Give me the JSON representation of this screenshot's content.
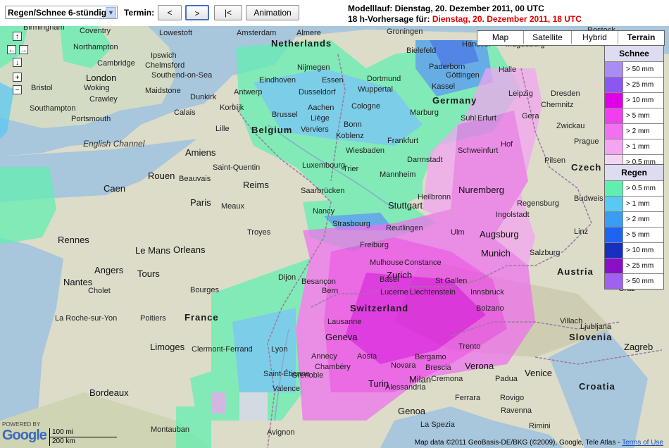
{
  "toolbar": {
    "product_select": "Regen/Schnee 6-stündig",
    "termin_label": "Termin:",
    "prev_label": "<",
    "next_label": ">",
    "first_label": "|<",
    "animation_label": "Animation"
  },
  "run_info": {
    "modelllauf": "Modelllauf: Dienstag, 20. Dezember 2011, 00 UTC",
    "forecast_prefix": "18 h-Vorhersage für:",
    "forecast_value": "Dienstag, 20. Dezember 2011, 18 UTC"
  },
  "map_types": [
    "Map",
    "Satellite",
    "Hybrid",
    "Terrain"
  ],
  "active_map_type": "Terrain",
  "legend_snow": {
    "title": "Schnee",
    "rows": [
      {
        "label": "> 50 mm",
        "color": "#a98cf4"
      },
      {
        "label": "> 25 mm",
        "color": "#8a58f0"
      },
      {
        "label": "> 10 mm",
        "color": "#e000e8"
      },
      {
        "label": "> 5 mm",
        "color": "#f040ee"
      },
      {
        "label": "> 2 mm",
        "color": "#f070f0"
      },
      {
        "label": "> 1 mm",
        "color": "#f4a4f2"
      },
      {
        "label": "> 0.5 mm",
        "color": "#f3d4f3"
      }
    ]
  },
  "legend_rain": {
    "title": "Regen",
    "rows": [
      {
        "label": "> 0.5 mm",
        "color": "#5ff0b0"
      },
      {
        "label": "> 1 mm",
        "color": "#58c8f4"
      },
      {
        "label": "> 2 mm",
        "color": "#3a9cf2"
      },
      {
        "label": "> 5 mm",
        "color": "#1f64f0"
      },
      {
        "label": "> 10 mm",
        "color": "#1830c0"
      },
      {
        "label": "> 25 mm",
        "color": "#8a10c8"
      },
      {
        "label": "> 50 mm",
        "color": "#a060f0"
      }
    ]
  },
  "map_labels": {
    "countries": [
      "Netherlands",
      "Belgium",
      "Germany",
      "France",
      "Switzerland",
      "Czech",
      "Austria",
      "Slovenia",
      "Croatia"
    ],
    "cities": [
      "Birmingham",
      "Coventry",
      "Lowestoft",
      "Amsterdam",
      "Almere",
      "Groningen",
      "Rostock",
      "Northampton",
      "Ipswich",
      "Bielefeld",
      "Hanover",
      "Magdeburg",
      "Cambridge",
      "Chelmsford",
      "Nijmegen",
      "Dortmund",
      "Paderborn",
      "Göttingen",
      "Halle",
      "London",
      "Southend-on-Sea",
      "Eindhoven",
      "Essen",
      "Wuppertal",
      "Kassel",
      "Leipzig",
      "Dresden",
      "Bristol",
      "Woking",
      "Maidstone",
      "Antwerp",
      "Dusseldorf",
      "Cologne",
      "Chemnitz",
      "Crawley",
      "Dunkirk",
      "Brussel",
      "Aachen",
      "Marburg",
      "Gera",
      "Southampton",
      "Portsmouth",
      "Calais",
      "Kortrijk",
      "Liège",
      "Bonn",
      "Erfurt",
      "Zwickau",
      "Lille",
      "Verviers",
      "Koblenz",
      "Suhl",
      "Hof",
      "Wiesbaden",
      "Frankfurt",
      "Schweinfurt",
      "Prague",
      "Amiens",
      "Luxembourg",
      "Darmstadt",
      "Pilsen",
      "Saint-Quentin",
      "Trier",
      "Mannheim",
      "Rouen",
      "Beauvais",
      "Reims",
      "Saarbrücken",
      "Nuremberg",
      "Caen",
      "Heilbronn",
      "Regensburg",
      "Budweis",
      "Paris",
      "Meaux",
      "Stuttgart",
      "Ingolstadt",
      "Nancy",
      "Strasbourg",
      "Ulm",
      "Augsburg",
      "Linz",
      "Rennes",
      "Troyes",
      "Reutlingen",
      "Le Mans",
      "Orleans",
      "Freiburg",
      "Munich",
      "Salzburg",
      "Mulhouse",
      "Constance",
      "Angers",
      "Tours",
      "Dijon",
      "Basel",
      "Zurich",
      "Nantes",
      "Cholet",
      "Bourges",
      "Besançon",
      "St Gallen",
      "Graz",
      "Lucerne",
      "Liechtenstein",
      "Innsbruck",
      "La Roche-sur-Yon",
      "Bern",
      "Villach",
      "Poitiers",
      "Lausanne",
      "Bolzano",
      "Geneva",
      "Trento",
      "Ljubljana",
      "Limoges",
      "Clermont-Ferrand",
      "Lyon",
      "Annecy",
      "Aosta",
      "Bergamo",
      "Verona",
      "Venice",
      "Zagreb",
      "Chambéry",
      "Novara",
      "Brescia",
      "Padua",
      "Saint-Étienne",
      "Grenoble",
      "Milan",
      "Cremona",
      "Bordeaux",
      "Valence",
      "Turin",
      "Alessandria",
      "Ferrara",
      "Rovigo",
      "Genoa",
      "Ravenna",
      "Montauban",
      "Avignon",
      "La Spezia",
      "Rimini"
    ],
    "seas": [
      "English Channel"
    ]
  },
  "scale": {
    "miles": "100 mi",
    "km": "200 km"
  },
  "powered_by": "POWERED BY",
  "google": "Google",
  "copyright": "Map data ©2011 GeoBasis-DE/BKG (©2009), Google, Tele Atlas -",
  "terms": "Terms of Use"
}
